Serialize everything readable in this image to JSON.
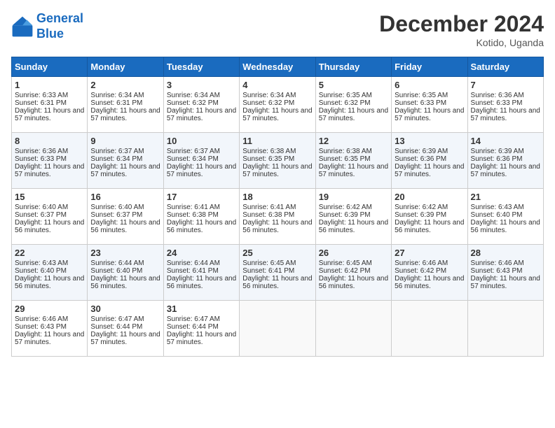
{
  "header": {
    "logo_line1": "General",
    "logo_line2": "Blue",
    "month_title": "December 2024",
    "location": "Kotido, Uganda"
  },
  "weekdays": [
    "Sunday",
    "Monday",
    "Tuesday",
    "Wednesday",
    "Thursday",
    "Friday",
    "Saturday"
  ],
  "weeks": [
    [
      {
        "day": "1",
        "sunrise": "6:33 AM",
        "sunset": "6:31 PM",
        "daylight": "11 hours and 57 minutes."
      },
      {
        "day": "2",
        "sunrise": "6:34 AM",
        "sunset": "6:31 PM",
        "daylight": "11 hours and 57 minutes."
      },
      {
        "day": "3",
        "sunrise": "6:34 AM",
        "sunset": "6:32 PM",
        "daylight": "11 hours and 57 minutes."
      },
      {
        "day": "4",
        "sunrise": "6:34 AM",
        "sunset": "6:32 PM",
        "daylight": "11 hours and 57 minutes."
      },
      {
        "day": "5",
        "sunrise": "6:35 AM",
        "sunset": "6:32 PM",
        "daylight": "11 hours and 57 minutes."
      },
      {
        "day": "6",
        "sunrise": "6:35 AM",
        "sunset": "6:33 PM",
        "daylight": "11 hours and 57 minutes."
      },
      {
        "day": "7",
        "sunrise": "6:36 AM",
        "sunset": "6:33 PM",
        "daylight": "11 hours and 57 minutes."
      }
    ],
    [
      {
        "day": "8",
        "sunrise": "6:36 AM",
        "sunset": "6:33 PM",
        "daylight": "11 hours and 57 minutes."
      },
      {
        "day": "9",
        "sunrise": "6:37 AM",
        "sunset": "6:34 PM",
        "daylight": "11 hours and 57 minutes."
      },
      {
        "day": "10",
        "sunrise": "6:37 AM",
        "sunset": "6:34 PM",
        "daylight": "11 hours and 57 minutes."
      },
      {
        "day": "11",
        "sunrise": "6:38 AM",
        "sunset": "6:35 PM",
        "daylight": "11 hours and 57 minutes."
      },
      {
        "day": "12",
        "sunrise": "6:38 AM",
        "sunset": "6:35 PM",
        "daylight": "11 hours and 57 minutes."
      },
      {
        "day": "13",
        "sunrise": "6:39 AM",
        "sunset": "6:36 PM",
        "daylight": "11 hours and 57 minutes."
      },
      {
        "day": "14",
        "sunrise": "6:39 AM",
        "sunset": "6:36 PM",
        "daylight": "11 hours and 57 minutes."
      }
    ],
    [
      {
        "day": "15",
        "sunrise": "6:40 AM",
        "sunset": "6:37 PM",
        "daylight": "11 hours and 56 minutes."
      },
      {
        "day": "16",
        "sunrise": "6:40 AM",
        "sunset": "6:37 PM",
        "daylight": "11 hours and 56 minutes."
      },
      {
        "day": "17",
        "sunrise": "6:41 AM",
        "sunset": "6:38 PM",
        "daylight": "11 hours and 56 minutes."
      },
      {
        "day": "18",
        "sunrise": "6:41 AM",
        "sunset": "6:38 PM",
        "daylight": "11 hours and 56 minutes."
      },
      {
        "day": "19",
        "sunrise": "6:42 AM",
        "sunset": "6:39 PM",
        "daylight": "11 hours and 56 minutes."
      },
      {
        "day": "20",
        "sunrise": "6:42 AM",
        "sunset": "6:39 PM",
        "daylight": "11 hours and 56 minutes."
      },
      {
        "day": "21",
        "sunrise": "6:43 AM",
        "sunset": "6:40 PM",
        "daylight": "11 hours and 56 minutes."
      }
    ],
    [
      {
        "day": "22",
        "sunrise": "6:43 AM",
        "sunset": "6:40 PM",
        "daylight": "11 hours and 56 minutes."
      },
      {
        "day": "23",
        "sunrise": "6:44 AM",
        "sunset": "6:40 PM",
        "daylight": "11 hours and 56 minutes."
      },
      {
        "day": "24",
        "sunrise": "6:44 AM",
        "sunset": "6:41 PM",
        "daylight": "11 hours and 56 minutes."
      },
      {
        "day": "25",
        "sunrise": "6:45 AM",
        "sunset": "6:41 PM",
        "daylight": "11 hours and 56 minutes."
      },
      {
        "day": "26",
        "sunrise": "6:45 AM",
        "sunset": "6:42 PM",
        "daylight": "11 hours and 56 minutes."
      },
      {
        "day": "27",
        "sunrise": "6:46 AM",
        "sunset": "6:42 PM",
        "daylight": "11 hours and 56 minutes."
      },
      {
        "day": "28",
        "sunrise": "6:46 AM",
        "sunset": "6:43 PM",
        "daylight": "11 hours and 57 minutes."
      }
    ],
    [
      {
        "day": "29",
        "sunrise": "6:46 AM",
        "sunset": "6:43 PM",
        "daylight": "11 hours and 57 minutes."
      },
      {
        "day": "30",
        "sunrise": "6:47 AM",
        "sunset": "6:44 PM",
        "daylight": "11 hours and 57 minutes."
      },
      {
        "day": "31",
        "sunrise": "6:47 AM",
        "sunset": "6:44 PM",
        "daylight": "11 hours and 57 minutes."
      },
      null,
      null,
      null,
      null
    ]
  ],
  "labels": {
    "sunrise": "Sunrise: ",
    "sunset": "Sunset: ",
    "daylight": "Daylight: "
  }
}
